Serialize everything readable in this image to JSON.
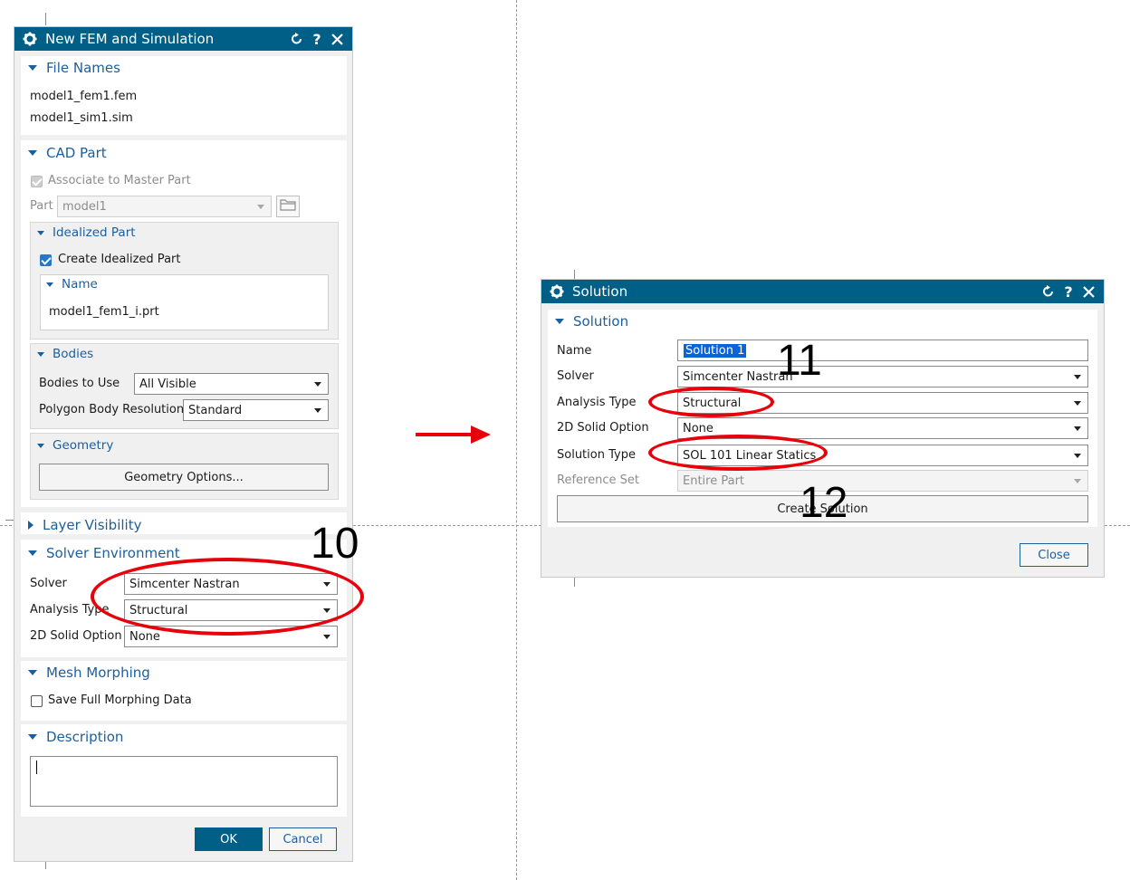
{
  "fem_dialog": {
    "title": "New FEM and Simulation",
    "file_names": {
      "heading": "File Names",
      "fem_file": "model1_fem1.fem",
      "sim_file": "model1_sim1.sim"
    },
    "cad_part": {
      "heading": "CAD Part",
      "associate_label": "Associate to Master Part",
      "part_label": "Part",
      "part_value": "model1",
      "idealized_part": {
        "heading": "Idealized Part",
        "create_label": "Create Idealized Part",
        "name_heading": "Name",
        "name_value": "model1_fem1_i.prt"
      },
      "bodies": {
        "heading": "Bodies",
        "bodies_to_use_label": "Bodies to Use",
        "bodies_to_use_value": "All Visible",
        "polygon_label": "Polygon Body Resolution",
        "polygon_value": "Standard"
      },
      "geometry": {
        "heading": "Geometry",
        "options_button": "Geometry Options..."
      }
    },
    "layer_visibility": {
      "heading": "Layer Visibility"
    },
    "solver_environment": {
      "heading": "Solver Environment",
      "solver_label": "Solver",
      "solver_value": "Simcenter Nastran",
      "analysis_label": "Analysis Type",
      "analysis_value": "Structural",
      "solid_label": "2D Solid Option",
      "solid_value": "None"
    },
    "mesh_morphing": {
      "heading": "Mesh Morphing",
      "save_label": "Save Full Morphing Data"
    },
    "description": {
      "heading": "Description"
    },
    "ok_button": "OK",
    "cancel_button": "Cancel"
  },
  "solution_dialog": {
    "title": "Solution",
    "heading": "Solution",
    "name_label": "Name",
    "name_value": "Solution 1",
    "solver_label": "Solver",
    "solver_value": "Simcenter Nastran",
    "analysis_label": "Analysis Type",
    "analysis_value": "Structural",
    "solid_label": "2D Solid Option",
    "solid_value": "None",
    "solution_type_label": "Solution Type",
    "solution_type_value": "SOL 101 Linear Statics",
    "reference_set_label": "Reference Set",
    "reference_set_value": "Entire Part",
    "create_button": "Create Solution",
    "close_button": "Close"
  },
  "annotations": {
    "step_10": "10",
    "step_11": "11",
    "step_12": "12",
    "highlight_color": "#e8000b"
  },
  "colors": {
    "titlebar": "#005f87",
    "link_blue": "#1b5f9e",
    "arrow_red": "#e8000b"
  }
}
